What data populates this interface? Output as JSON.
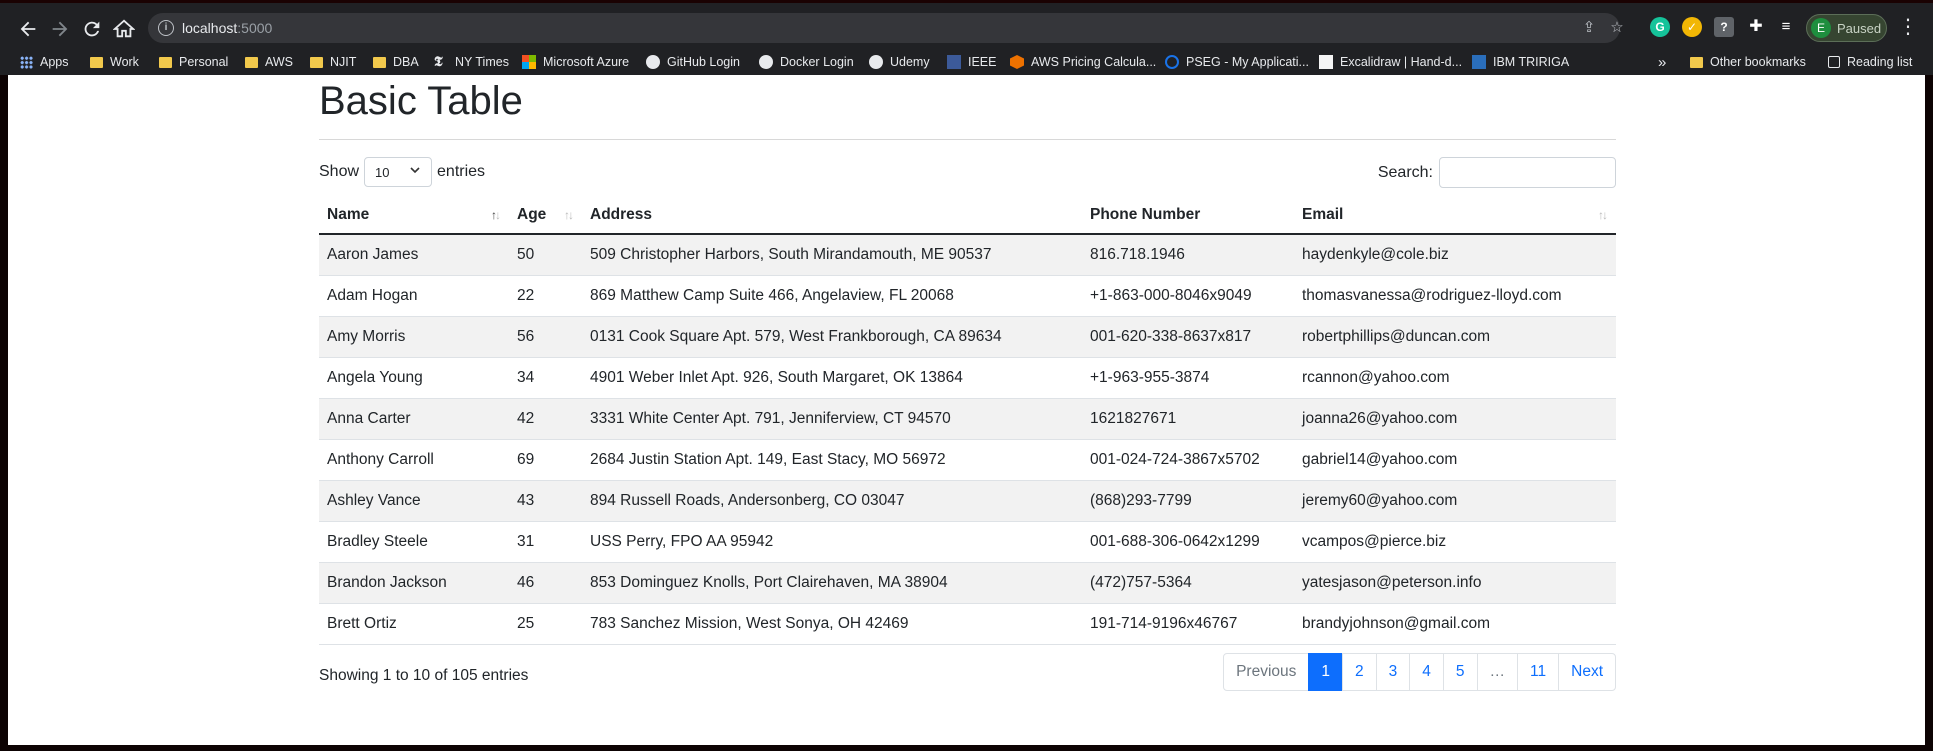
{
  "browser": {
    "url_host": "localhost",
    "url_port": ":5000",
    "profile_initial": "E",
    "profile_status": "Paused",
    "bookmarks": [
      {
        "label": "Apps",
        "icon": "apps-grid-icon"
      },
      {
        "label": "Work",
        "icon": "folder-icon"
      },
      {
        "label": "Personal",
        "icon": "folder-icon"
      },
      {
        "label": "AWS",
        "icon": "folder-icon"
      },
      {
        "label": "NJIT",
        "icon": "folder-icon"
      },
      {
        "label": "DBA",
        "icon": "folder-icon"
      },
      {
        "label": "NY Times",
        "icon": "nytimes-icon"
      },
      {
        "label": "Microsoft Azure",
        "icon": "microsoft-icon"
      },
      {
        "label": "GitHub Login",
        "icon": "github-icon"
      },
      {
        "label": "Docker Login",
        "icon": "docker-icon"
      },
      {
        "label": "Udemy",
        "icon": "udemy-icon"
      },
      {
        "label": "IEEE",
        "icon": "ieee-icon"
      },
      {
        "label": "AWS Pricing Calcula...",
        "icon": "aws-icon"
      },
      {
        "label": "PSEG - My Applicati...",
        "icon": "pseg-icon"
      },
      {
        "label": "Excalidraw | Hand-d...",
        "icon": "excalidraw-icon"
      },
      {
        "label": "IBM TRIRIGA",
        "icon": "ibm-icon"
      }
    ],
    "overflow_label": "»",
    "other_bookmarks": "Other bookmarks",
    "reading_list": "Reading list"
  },
  "page": {
    "title": "Basic Table",
    "length_prefix": "Show",
    "length_value": "10",
    "length_suffix": "entries",
    "search_label": "Search:",
    "search_value": "",
    "columns": [
      "Name",
      "Age",
      "Address",
      "Phone Number",
      "Email"
    ],
    "rows": [
      [
        "Aaron James",
        "50",
        "509 Christopher Harbors, South Mirandamouth, ME 90537",
        "816.718.1946",
        "haydenkyle@cole.biz"
      ],
      [
        "Adam Hogan",
        "22",
        "869 Matthew Camp Suite 466, Angelaview, FL 20068",
        "+1-863-000-8046x9049",
        "thomasvanessa@rodriguez-lloyd.com"
      ],
      [
        "Amy Morris",
        "56",
        "0131 Cook Square Apt. 579, West Frankborough, CA 89634",
        "001-620-338-8637x817",
        "robertphillips@duncan.com"
      ],
      [
        "Angela Young",
        "34",
        "4901 Weber Inlet Apt. 926, South Margaret, OK 13864",
        "+1-963-955-3874",
        "rcannon@yahoo.com"
      ],
      [
        "Anna Carter",
        "42",
        "3331 White Center Apt. 791, Jenniferview, CT 94570",
        "1621827671",
        "joanna26@yahoo.com"
      ],
      [
        "Anthony Carroll",
        "69",
        "2684 Justin Station Apt. 149, East Stacy, MO 56972",
        "001-024-724-3867x5702",
        "gabriel14@yahoo.com"
      ],
      [
        "Ashley Vance",
        "43",
        "894 Russell Roads, Andersonberg, CO 03047",
        "(868)293-7799",
        "jeremy60@yahoo.com"
      ],
      [
        "Bradley Steele",
        "31",
        "USS Perry, FPO AA 95942",
        "001-688-306-0642x1299",
        "vcampos@pierce.biz"
      ],
      [
        "Brandon Jackson",
        "46",
        "853 Dominguez Knolls, Port Clairehaven, MA 38904",
        "(472)757-5364",
        "yatesjason@peterson.info"
      ],
      [
        "Brett Ortiz",
        "25",
        "783 Sanchez Mission, West Sonya, OH 42469",
        "191-714-9196x46767",
        "brandyjohnson@gmail.com"
      ]
    ],
    "info": "Showing 1 to 10 of 105 entries",
    "pagination": {
      "previous": "Previous",
      "pages": [
        "1",
        "2",
        "3",
        "4",
        "5",
        "…",
        "11"
      ],
      "active": "1",
      "next": "Next"
    }
  }
}
